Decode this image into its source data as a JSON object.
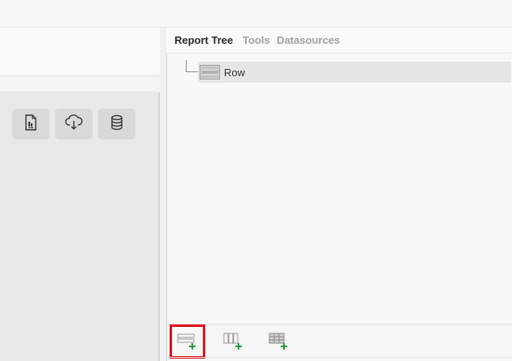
{
  "tabs": [
    {
      "label": "Report Tree",
      "active": true
    },
    {
      "label": "Tools",
      "active": false
    },
    {
      "label": "Datasources",
      "active": false
    }
  ],
  "tree": {
    "items": [
      {
        "label": "Row",
        "icon": "row-layout-icon",
        "selected": true
      }
    ]
  },
  "left_toolbar": {
    "buttons": [
      {
        "icon": "report-document-icon"
      },
      {
        "icon": "cloud-download-icon"
      },
      {
        "icon": "database-icon"
      }
    ]
  },
  "bottom_toolbar": {
    "buttons": [
      {
        "icon": "add-row-icon",
        "highlighted": true
      },
      {
        "icon": "add-column-icon",
        "highlighted": false
      },
      {
        "icon": "add-table-icon",
        "highlighted": false
      }
    ]
  },
  "colors": {
    "highlight": "#e0101a",
    "add_plus": "#1e9e3a",
    "tab_active": "#2a2a2a",
    "tab_inactive": "#a0a0a0"
  }
}
